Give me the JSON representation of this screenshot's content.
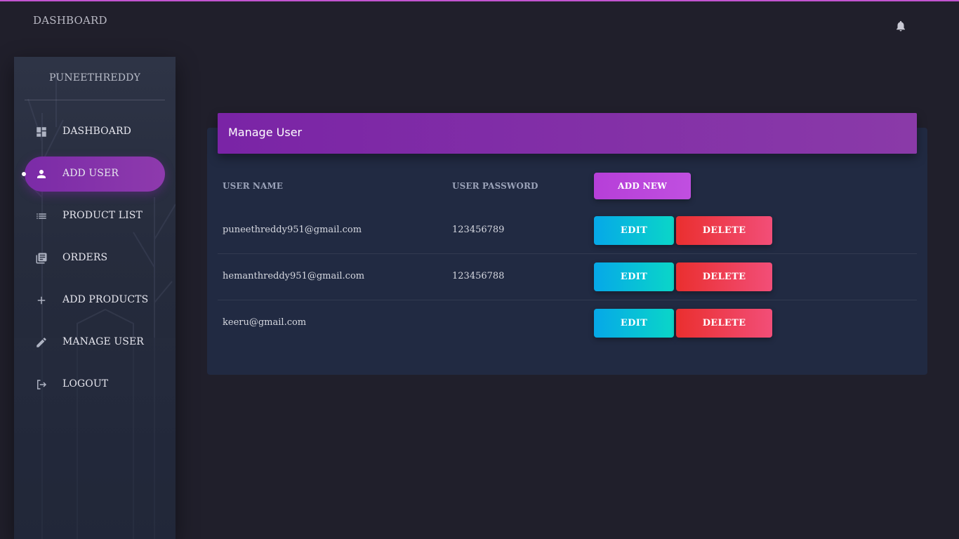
{
  "navbar": {
    "brand": "DASHBOARD",
    "notification_icon": "bell-icon"
  },
  "sidebar": {
    "username": "PUNEETHREDDY",
    "items": [
      {
        "label": "DASHBOARD",
        "icon": "dashboard-grid-icon",
        "active": false
      },
      {
        "label": "ADD USER",
        "icon": "person-icon",
        "active": true
      },
      {
        "label": "PRODUCT LIST",
        "icon": "list-icon",
        "active": false
      },
      {
        "label": "ORDERS",
        "icon": "library-books-icon",
        "active": false
      },
      {
        "label": "ADD PRODUCTS",
        "icon": "plus-icon",
        "active": false
      },
      {
        "label": "MANAGE USER",
        "icon": "pencil-icon",
        "active": false
      },
      {
        "label": "LOGOUT",
        "icon": "logout-icon",
        "active": false
      }
    ]
  },
  "card": {
    "title": "Manage User",
    "columns": [
      "USER NAME",
      "USER PASSWORD"
    ],
    "add_new_label": "ADD NEW",
    "edit_label": "EDIT",
    "delete_label": "DELETE",
    "rows": [
      {
        "username": "puneethreddy951@gmail.com",
        "password": "123456789"
      },
      {
        "username": "hemanthreddy951@gmail.com",
        "password": "123456788"
      },
      {
        "username": "keeru@gmail.com",
        "password": ""
      }
    ]
  },
  "colors": {
    "accent_purple": "#7b2ba7",
    "add_button": "#b63fd8",
    "edit_button": "#06a8e8",
    "delete_button": "#ea2f2f",
    "background": "#201f2b",
    "card_background": "#212a42"
  }
}
